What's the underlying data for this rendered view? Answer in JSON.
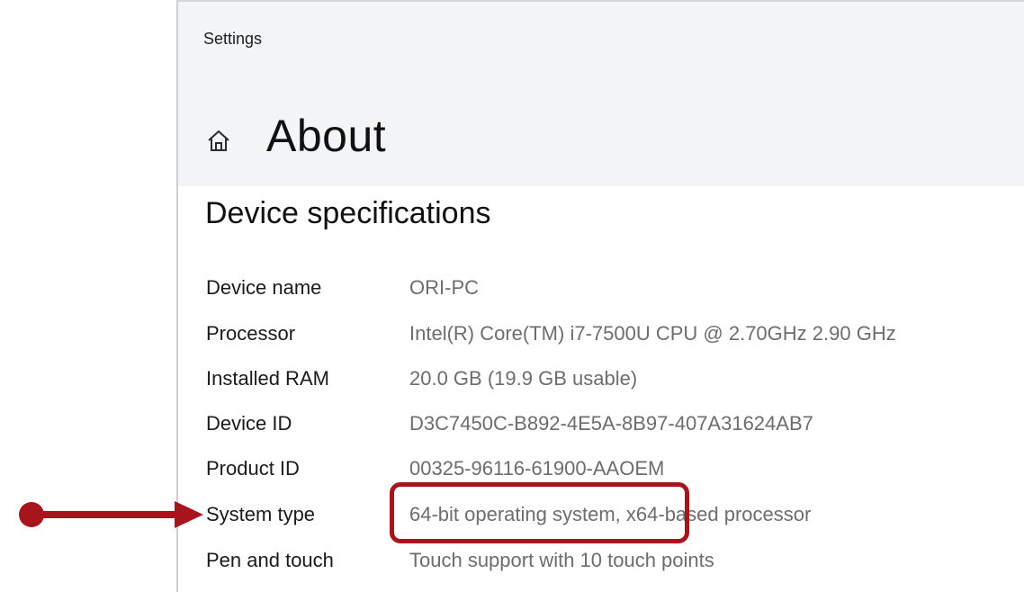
{
  "window": {
    "title": "Settings",
    "page_title": "About",
    "home_icon": "home-icon"
  },
  "device_specifications": {
    "heading": "Device specifications",
    "rows": [
      {
        "label": "Device name",
        "value": "ORI-PC"
      },
      {
        "label": "Processor",
        "value": "Intel(R) Core(TM) i7-7500U CPU @ 2.70GHz   2.90 GHz"
      },
      {
        "label": "Installed RAM",
        "value": "20.0 GB (19.9 GB usable)"
      },
      {
        "label": "Device ID",
        "value": "D3C7450C-B892-4E5A-8B97-407A31624AB7"
      },
      {
        "label": "Product ID",
        "value": "00325-96116-61900-AAOEM"
      },
      {
        "label": "System type",
        "value": "64-bit operating system, x64-based processor"
      },
      {
        "label": "Pen and touch",
        "value": "Touch support with 10 touch points"
      }
    ]
  },
  "annotation": {
    "color": "#a8141b",
    "highlight": "system-type-value",
    "arrow_target": "system-type-label"
  }
}
